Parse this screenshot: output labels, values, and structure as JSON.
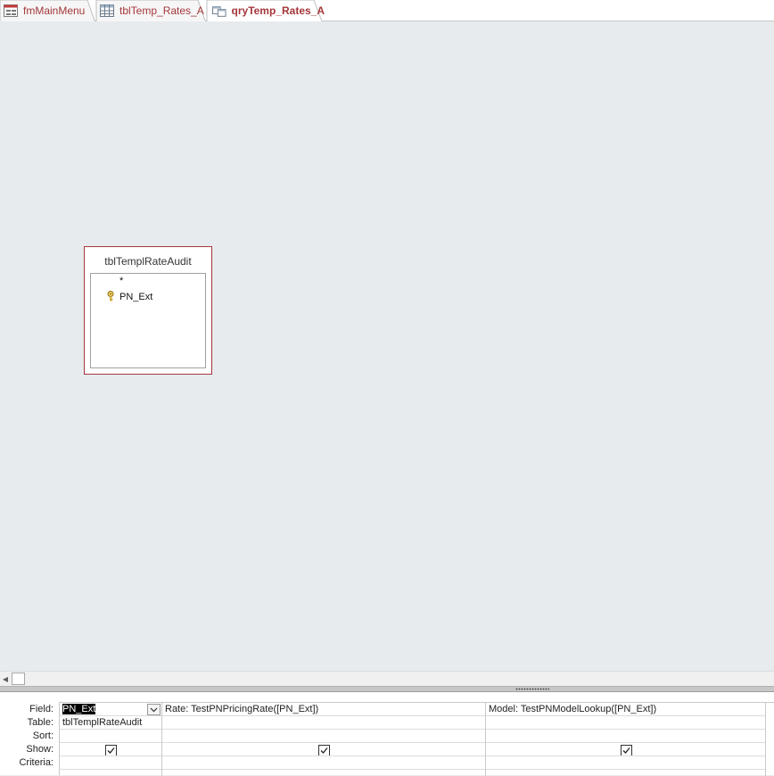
{
  "tabs": [
    {
      "label": "fmMainMenu",
      "icon": "form-icon",
      "active": false
    },
    {
      "label": "tblTemp_Rates_A",
      "icon": "table-icon",
      "active": false
    },
    {
      "label": "qryTemp_Rates_A",
      "icon": "query-icon",
      "active": true
    }
  ],
  "table_box": {
    "title": "tblTemplRateAudit",
    "fields": [
      {
        "name": "*",
        "key": false
      },
      {
        "name": "PN_Ext",
        "key": true
      }
    ]
  },
  "qbe": {
    "row_labels": {
      "field": "Field:",
      "table": "Table:",
      "sort": "Sort:",
      "show": "Show:",
      "criteria": "Criteria:"
    },
    "columns": [
      {
        "field": "PN_Ext",
        "table": "tblTemplRateAudit",
        "sort": "",
        "show": true,
        "criteria": ""
      },
      {
        "field": "Rate: TestPNPricingRate([PN_Ext])",
        "table": "",
        "sort": "",
        "show": true,
        "criteria": ""
      },
      {
        "field": "Model: TestPNModelLookup([PN_Ext])",
        "table": "",
        "sort": "",
        "show": true,
        "criteria": ""
      }
    ]
  },
  "colors": {
    "accent": "#a4373a",
    "surface": "#e8ebee"
  }
}
